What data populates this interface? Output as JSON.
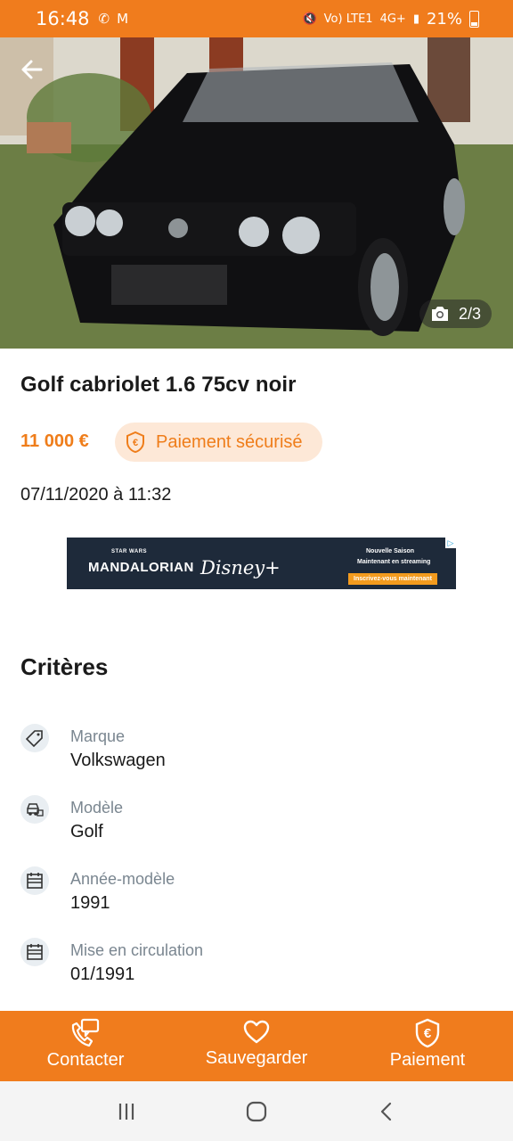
{
  "status_bar": {
    "time": "16:48",
    "network": "Vo) LTE1",
    "signal": "4G+",
    "battery": "21%"
  },
  "gallery": {
    "counter": "2/3"
  },
  "ad": {
    "star_wars": "STAR WARS",
    "title": "MANDALORIAN",
    "brand": "Disney+",
    "line1": "Nouvelle Saison",
    "line2": "Maintenant en streaming",
    "cta": "Inscrivez-vous maintenant"
  },
  "listing": {
    "title": "Golf cabriolet 1.6 75cv noir",
    "price": "11 000 €",
    "secure_payment": "Paiement sécurisé",
    "date": "07/11/2020 à 11:32"
  },
  "criteria": {
    "title": "Critères",
    "items": [
      {
        "label": "Marque",
        "value": "Volkswagen",
        "icon": "tag-icon"
      },
      {
        "label": "Modèle",
        "value": "Golf",
        "icon": "car-icon"
      },
      {
        "label": "Année-modèle",
        "value": "1991",
        "icon": "calendar-icon"
      },
      {
        "label": "Mise en circulation",
        "value": "01/1991",
        "icon": "calendar-icon"
      }
    ]
  },
  "actions": {
    "contact": "Contacter",
    "save": "Sauvegarder",
    "payment": "Paiement"
  },
  "colors": {
    "brand": "#f07c1d",
    "accent_text": "#ef7d1a",
    "chip_bg": "#fde8d7"
  }
}
